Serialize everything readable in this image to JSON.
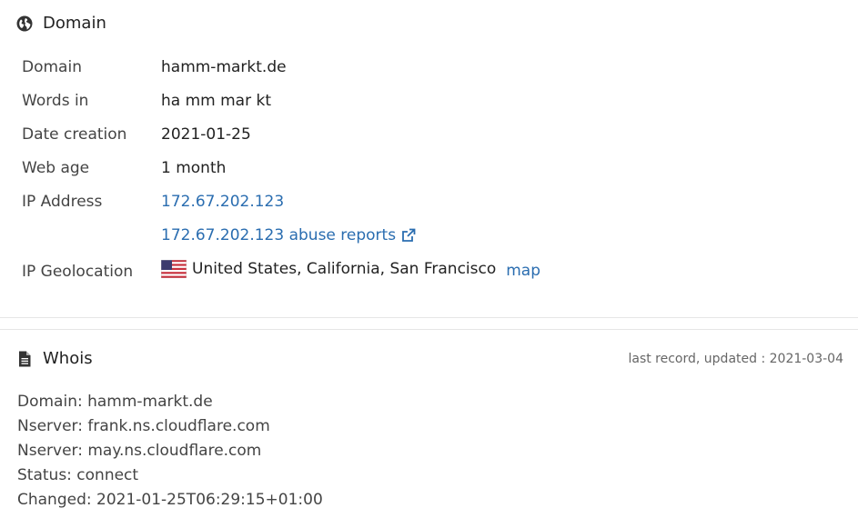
{
  "domain_section": {
    "title": "Domain",
    "rows": [
      {
        "label": "Domain",
        "value": "hamm-markt.de"
      },
      {
        "label": "Words in",
        "value": "ha mm mar kt"
      },
      {
        "label": "Date creation",
        "value": "2021-01-25"
      },
      {
        "label": "Web age",
        "value": "1 month"
      },
      {
        "label": "IP Address",
        "value": "172.67.202.123"
      },
      {
        "label": "",
        "value": "172.67.202.123 abuse reports"
      },
      {
        "label": "IP Geolocation",
        "value": "United States, California, San Francisco",
        "link": "map"
      }
    ]
  },
  "whois_section": {
    "title": "Whois",
    "updated": "last record, updated : 2021-03-04",
    "lines": [
      "Domain: hamm-markt.de",
      "Nserver: frank.ns.cloudflare.com",
      "Nserver: may.ns.cloudflare.com",
      "Status: connect",
      "Changed: 2021-01-25T06:29:15+01:00"
    ]
  },
  "colors": {
    "link": "#2a6db0",
    "text": "#333333",
    "divider": "#e6e6e6"
  }
}
